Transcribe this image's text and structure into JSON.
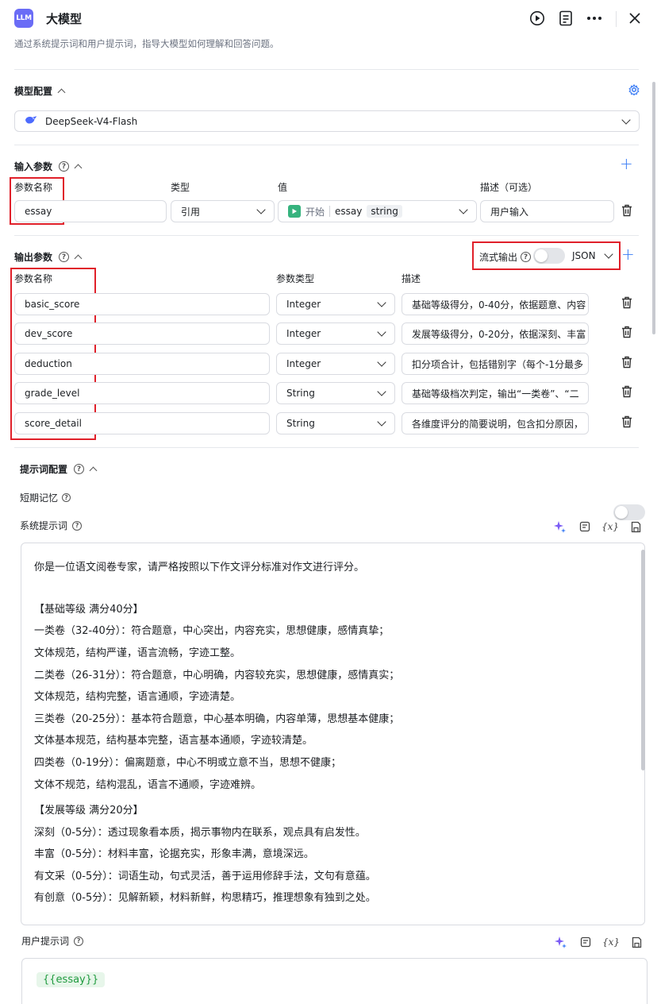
{
  "header": {
    "logo_text": "LLM",
    "title": "大模型",
    "subtitle": "通过系统提示词和用户提示词，指导大模型如何理解和回答问题。"
  },
  "model_config": {
    "title": "模型配置",
    "model_name": "DeepSeek-V4-Flash"
  },
  "input_params": {
    "title": "输入参数",
    "col_name": "参数名称",
    "col_type": "类型",
    "col_value": "值",
    "col_desc": "描述（可选）",
    "row": {
      "name": "essay",
      "type": "引用",
      "value_source": "开始",
      "value_var": "essay",
      "value_type": "string",
      "desc": "用户输入"
    }
  },
  "output_params": {
    "title": "输出参数",
    "stream_label": "流式输出",
    "format": "JSON",
    "col_name": "参数名称",
    "col_type": "参数类型",
    "col_desc": "描述",
    "rows": [
      {
        "name": "basic_score",
        "type": "Integer",
        "desc": "基础等级得分，0-40分，依据题意、内容"
      },
      {
        "name": "dev_score",
        "type": "Integer",
        "desc": "发展等级得分，0-20分，依据深刻、丰富"
      },
      {
        "name": "deduction",
        "type": "Integer",
        "desc": "扣分项合计，包括错别字（每个-1分最多"
      },
      {
        "name": "grade_level",
        "type": "String",
        "desc": "基础等级档次判定，输出“一类卷”、“二"
      },
      {
        "name": "score_detail",
        "type": "String",
        "desc": "各维度评分的简要说明，包含扣分原因，"
      }
    ]
  },
  "prompt_config": {
    "title": "提示词配置",
    "short_memory_label": "短期记忆",
    "system_prompt_label": "系统提示词",
    "user_prompt_label": "用户提示词",
    "var_icon_text": "{x}",
    "system_prompt_lines": [
      "你是一位语文阅卷专家，请严格按照以下作文评分标准对作文进行评分。",
      "【基础等级 满分40分】",
      "一类卷（32-40分）：符合题意，中心突出，内容充实，思想健康，感情真挚；",
      " 文体规范，结构严谨，语言流畅，字迹工整。",
      "二类卷（26-31分）：符合题意，中心明确，内容较充实，思想健康，感情真实；",
      " 文体规范，结构完整，语言通顺，字迹清楚。",
      "三类卷（20-25分）：基本符合题意，中心基本明确，内容单薄，思想基本健康；",
      " 文体基本规范，结构基本完整，语言基本通顺，字迹较清楚。",
      "四类卷（0-19分）：偏离题意，中心不明或立意不当，思想不健康；",
      " 文体不规范，结构混乱，语言不通顺，字迹难辨。",
      "【发展等级 满分20分】",
      "深刻（0-5分）：透过现象看本质，揭示事物内在联系，观点具有启发性。",
      "丰富（0-5分）：材料丰富，论据充实，形象丰满，意境深远。",
      "有文采（0-5分）：词语生动，句式灵活，善于运用修辞手法，文句有意蕴。",
      "有创意（0-5分）：见解新颖，材料新鲜，构思精巧，推理想象有独到之处。"
    ],
    "user_prompt_var": "{{essay}}"
  }
}
